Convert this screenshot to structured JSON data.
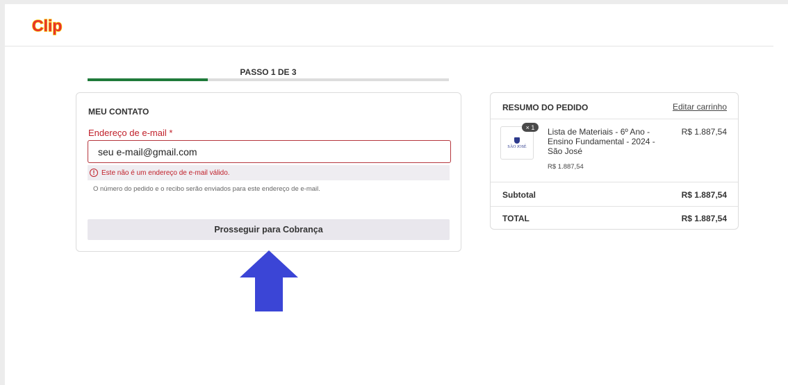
{
  "brand": {
    "logo_text": "Clip",
    "logo_color": "#e8332a",
    "logo_outline_color": "#f7c600"
  },
  "progress": {
    "label": "PASSO 1 DE 3",
    "fraction": 0.333,
    "fill_color": "#1f7a3a"
  },
  "contact": {
    "title": "MEU CONTATO",
    "email_label": "Endereço de e-mail *",
    "email_value": "seu e-mail@gmail.com",
    "error_icon": "alert-circle-icon",
    "error_message": "Este não é um endereço de e-mail válido.",
    "hint": "O número do pedido e o recibo serão enviados para este endereço de e-mail.",
    "continue_label": "Prosseguir para Cobrança",
    "error_color": "#c0202a"
  },
  "annotation": {
    "arrow_icon": "arrow-up-icon",
    "arrow_color": "#3b45d6"
  },
  "summary": {
    "title": "RESUMO DO PEDIDO",
    "edit_cart": "Editar carrinho",
    "item": {
      "quantity": "× 1",
      "thumb_text": "SÃO JOSÉ",
      "name": "Lista de Materiais - 6º Ano - Ensino Fundamental - 2024 - São José",
      "unit_price": "R$ 1.887,54",
      "price": "R$ 1.887,54"
    },
    "subtotal_label": "Subtotal",
    "subtotal_value": "R$ 1.887,54",
    "total_label": "TOTAL",
    "total_value": "R$ 1.887,54"
  }
}
